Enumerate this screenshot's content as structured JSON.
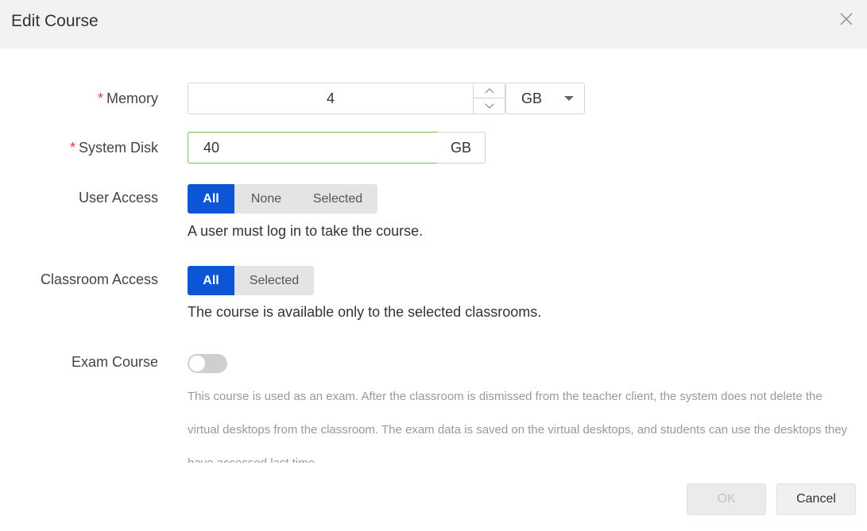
{
  "dialog": {
    "title": "Edit Course",
    "close_icon": "close-icon"
  },
  "form": {
    "memory": {
      "required_mark": "*",
      "label": "Memory",
      "value": "4",
      "unit": "GB",
      "up_icon": "chevron-up-icon",
      "down_icon": "chevron-down-icon",
      "caret_icon": "caret-down-icon"
    },
    "system_disk": {
      "required_mark": "*",
      "label": "System Disk",
      "value": "40",
      "unit": "GB"
    },
    "user_access": {
      "label": "User Access",
      "options": [
        "All",
        "None",
        "Selected"
      ],
      "selected": "All",
      "hint": "A user must log in to take the course."
    },
    "classroom_access": {
      "label": "Classroom Access",
      "options": [
        "All",
        "Selected"
      ],
      "selected": "All",
      "hint": "The course is available only to the selected classrooms."
    },
    "exam_course": {
      "label": "Exam Course",
      "enabled": false,
      "description": "This course is used as an exam. After the classroom is dismissed from the teacher client, the system does not delete the virtual desktops from the classroom. The exam data is saved on the virtual desktops, and students can use the desktops they have accessed last time."
    }
  },
  "footer": {
    "ok_label": "OK",
    "cancel_label": "Cancel",
    "ok_disabled": true
  },
  "colors": {
    "primary": "#0b55d6",
    "required": "#e43a3a",
    "focus_border": "#7cc04b",
    "header_bg": "#f2f2f2"
  }
}
